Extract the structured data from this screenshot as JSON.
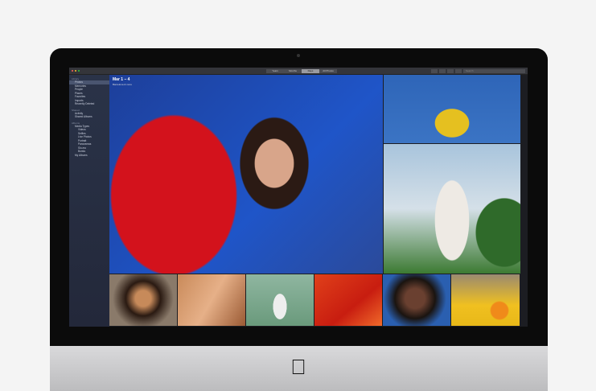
{
  "toolbar": {
    "views": [
      "Years",
      "Months",
      "Days",
      "All Photos"
    ],
    "active_view": "Days",
    "search_placeholder": "Search"
  },
  "sidebar": {
    "sections": [
      {
        "title": "Library",
        "items": [
          "Photos",
          "Memories",
          "People",
          "Places",
          "Favorites",
          "Imports",
          "Recently Deleted"
        ]
      },
      {
        "title": "Shared",
        "items": [
          "Activity",
          "Shared Albums"
        ]
      },
      {
        "title": "Albums",
        "items": [
          "Media Types",
          "Videos",
          "Selfies",
          "Live Photos",
          "Portrait",
          "Panoramas",
          "Slo-mo",
          "Bursts",
          "My Albums"
        ]
      }
    ],
    "selected": "Photos"
  },
  "content": {
    "date_title": "Mar 1 – 4",
    "location_subtitle": "Barcelona & more"
  },
  "colors": {
    "accent_red": "#d3121c",
    "sky_blue": "#1f55c8",
    "sidebar": "#2a3348"
  },
  "icons": {
    "logo": "apple-logo"
  }
}
